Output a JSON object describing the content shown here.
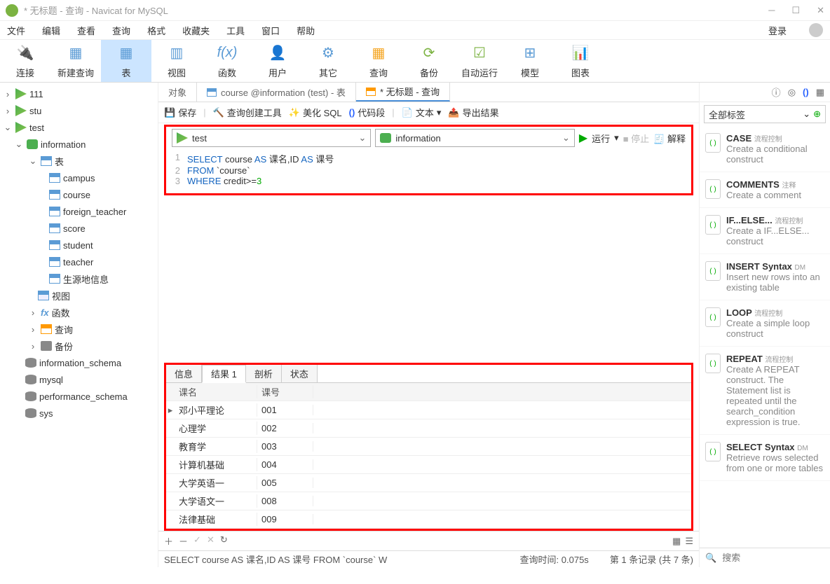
{
  "window_title": "* 无标题 - 查询 - Navicat for MySQL",
  "menus": [
    "文件",
    "编辑",
    "查看",
    "查询",
    "格式",
    "收藏夹",
    "工具",
    "窗口",
    "帮助"
  ],
  "login": "登录",
  "toolbar": [
    "连接",
    "新建查询",
    "表",
    "视图",
    "函数",
    "用户",
    "其它",
    "查询",
    "备份",
    "自动运行",
    "模型",
    "图表"
  ],
  "tree": {
    "conns": [
      "111",
      "stu",
      "test"
    ],
    "db": "information",
    "tables_label": "表",
    "tables": [
      "campus",
      "course",
      "foreign_teacher",
      "score",
      "student",
      "teacher",
      "生源地信息"
    ],
    "views": "视图",
    "funcs": "函数",
    "queries": "查询",
    "backup": "备份",
    "other_dbs": [
      "information_schema",
      "mysql",
      "performance_schema",
      "sys"
    ]
  },
  "tabs": {
    "objects": "对象",
    "course_tab": "course @information (test) - 表",
    "query_tab": "* 无标题 - 查询"
  },
  "subbar": {
    "save": "保存",
    "builder": "查询创建工具",
    "beautify": "美化 SQL",
    "snippet": "代码段",
    "text": "文本",
    "export": "导出结果"
  },
  "dd": {
    "conn": "test",
    "db": "information",
    "run": "运行",
    "stop": "停止",
    "explain": "解释"
  },
  "sql": {
    "l1a": "SELECT",
    "l1b": "course",
    "l1c": "AS",
    "l1d": "课名,ID",
    "l1e": "AS",
    "l1f": "课号",
    "l2a": "FROM",
    "l2b": "`course`",
    "l3a": "WHERE",
    "l3b": "credit>=",
    "l3c": "3"
  },
  "result_tabs": [
    "信息",
    "结果 1",
    "剖析",
    "状态"
  ],
  "columns": [
    "课名",
    "课号"
  ],
  "rows": [
    {
      "c1": "邓小平理论",
      "c2": "001"
    },
    {
      "c1": "心理学",
      "c2": "002"
    },
    {
      "c1": "教育学",
      "c2": "003"
    },
    {
      "c1": "计算机基础",
      "c2": "004"
    },
    {
      "c1": "大学英语一",
      "c2": "005"
    },
    {
      "c1": "大学语文一",
      "c2": "008"
    },
    {
      "c1": "法律基础",
      "c2": "009"
    }
  ],
  "status": {
    "sql": "SELECT course AS 课名,ID AS 课号 FROM `course` W",
    "time": "查询时间: 0.075s",
    "rec": "第 1 条记录 (共 7 条)"
  },
  "tags_label": "全部标签",
  "snippets": [
    {
      "h": "CASE",
      "sub": "流程控制",
      "d": "Create a conditional construct"
    },
    {
      "h": "COMMENTS",
      "sub": "注释",
      "d": "Create a comment"
    },
    {
      "h": "IF...ELSE...",
      "sub": "流程控制",
      "d": "Create a IF...ELSE... construct"
    },
    {
      "h": "INSERT Syntax",
      "sub": "DM",
      "d": "Insert new rows into an existing table"
    },
    {
      "h": "LOOP",
      "sub": "流程控制",
      "d": "Create a simple loop construct"
    },
    {
      "h": "REPEAT",
      "sub": "流程控制",
      "d": "Create A REPEAT construct. The Statement list is repeated until the search_condition expression is true."
    },
    {
      "h": "SELECT Syntax",
      "sub": "DM",
      "d": "Retrieve rows selected from one or more tables"
    }
  ],
  "search_placeholder": "搜索"
}
